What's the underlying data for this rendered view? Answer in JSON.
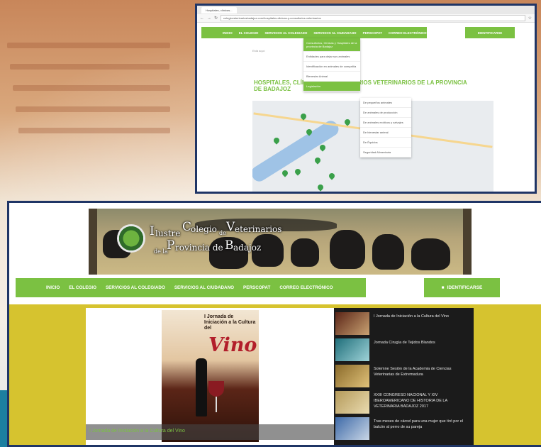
{
  "top_window": {
    "tab_title": "Hospitales, clínicas...",
    "url": "colegioveterinariosbadajoz.com/hospitales-clinicas-y-consultorios-veterinarios",
    "nav_items": [
      "INICIO",
      "EL COLEGIO",
      "SERVICIOS AL COLEGIADO",
      "SERVICIOS AL CIUDADANO",
      "PERSCOPAT",
      "CORREO ELECTRÓNICO"
    ],
    "identify_label": "IDENTIFICARSE",
    "breadcrumb": "Está aquí:",
    "page_title": "HOSPITALES, CLÍNICAS Y CONSULTORIOS VETERINARIOS DE LA PROVINCIA DE BADAJOZ",
    "dropdown_items": [
      "Consultorios, Clínicas y Hospitales de la provincia de Badajoz",
      "Entidades para dejar sus animales",
      "Identificación en animales de compañía",
      "Bienestar Animal",
      "Legislación"
    ],
    "submenu_items": [
      "De pequeños animales",
      "De animales de producción",
      "De animales exóticos y salvajes",
      "De bienestar animal",
      "De Équidos",
      "Seguridad Alimentaria"
    ]
  },
  "bottom_window": {
    "logo_text": {
      "line1_a": "I",
      "line1_b": "lustre ",
      "line1_c": "C",
      "line1_d": "olegio ",
      "line1_e": "de ",
      "line1_f": "V",
      "line1_g": "eterinarios",
      "line2_a": "de la ",
      "line2_b": "P",
      "line2_c": "rovincia de ",
      "line2_d": "B",
      "line2_e": "adajoz"
    },
    "nav_items": [
      "INICIO",
      "EL COLEGIO",
      "SERVICIOS AL COLEGIADO",
      "SERVICIOS AL CIUDADANO",
      "PERSCOPAT",
      "CORREO ELECTRÓNICO"
    ],
    "identify_label": "IDENTIFICARSE",
    "poster_title": "I Jornada de Iniciación a la Cultura del",
    "poster_word": "Vino",
    "slider_caption": "I Jornada de Iniciación a la Cultura del Vino",
    "news": [
      "I Jornada de Iniciación a la Cultura del Vino",
      "Jornada Cirugía de Tejidos Blandos",
      "Solemne Sesión de la Academia de Ciencias Veterinarias de Extremadura",
      "XXIII CONGRESO NACIONAL Y XIV IBEROAMERICANO DE HISTORIA DE LA VETERINARIA BADAJOZ 2017",
      "Tras meses de cárcel para una mujer que tiró por el balcón al perro de su pareja"
    ]
  },
  "colors": {
    "brand_green": "#7bc142",
    "frame_navy": "#1f3566",
    "olive": "#d6c32f"
  }
}
